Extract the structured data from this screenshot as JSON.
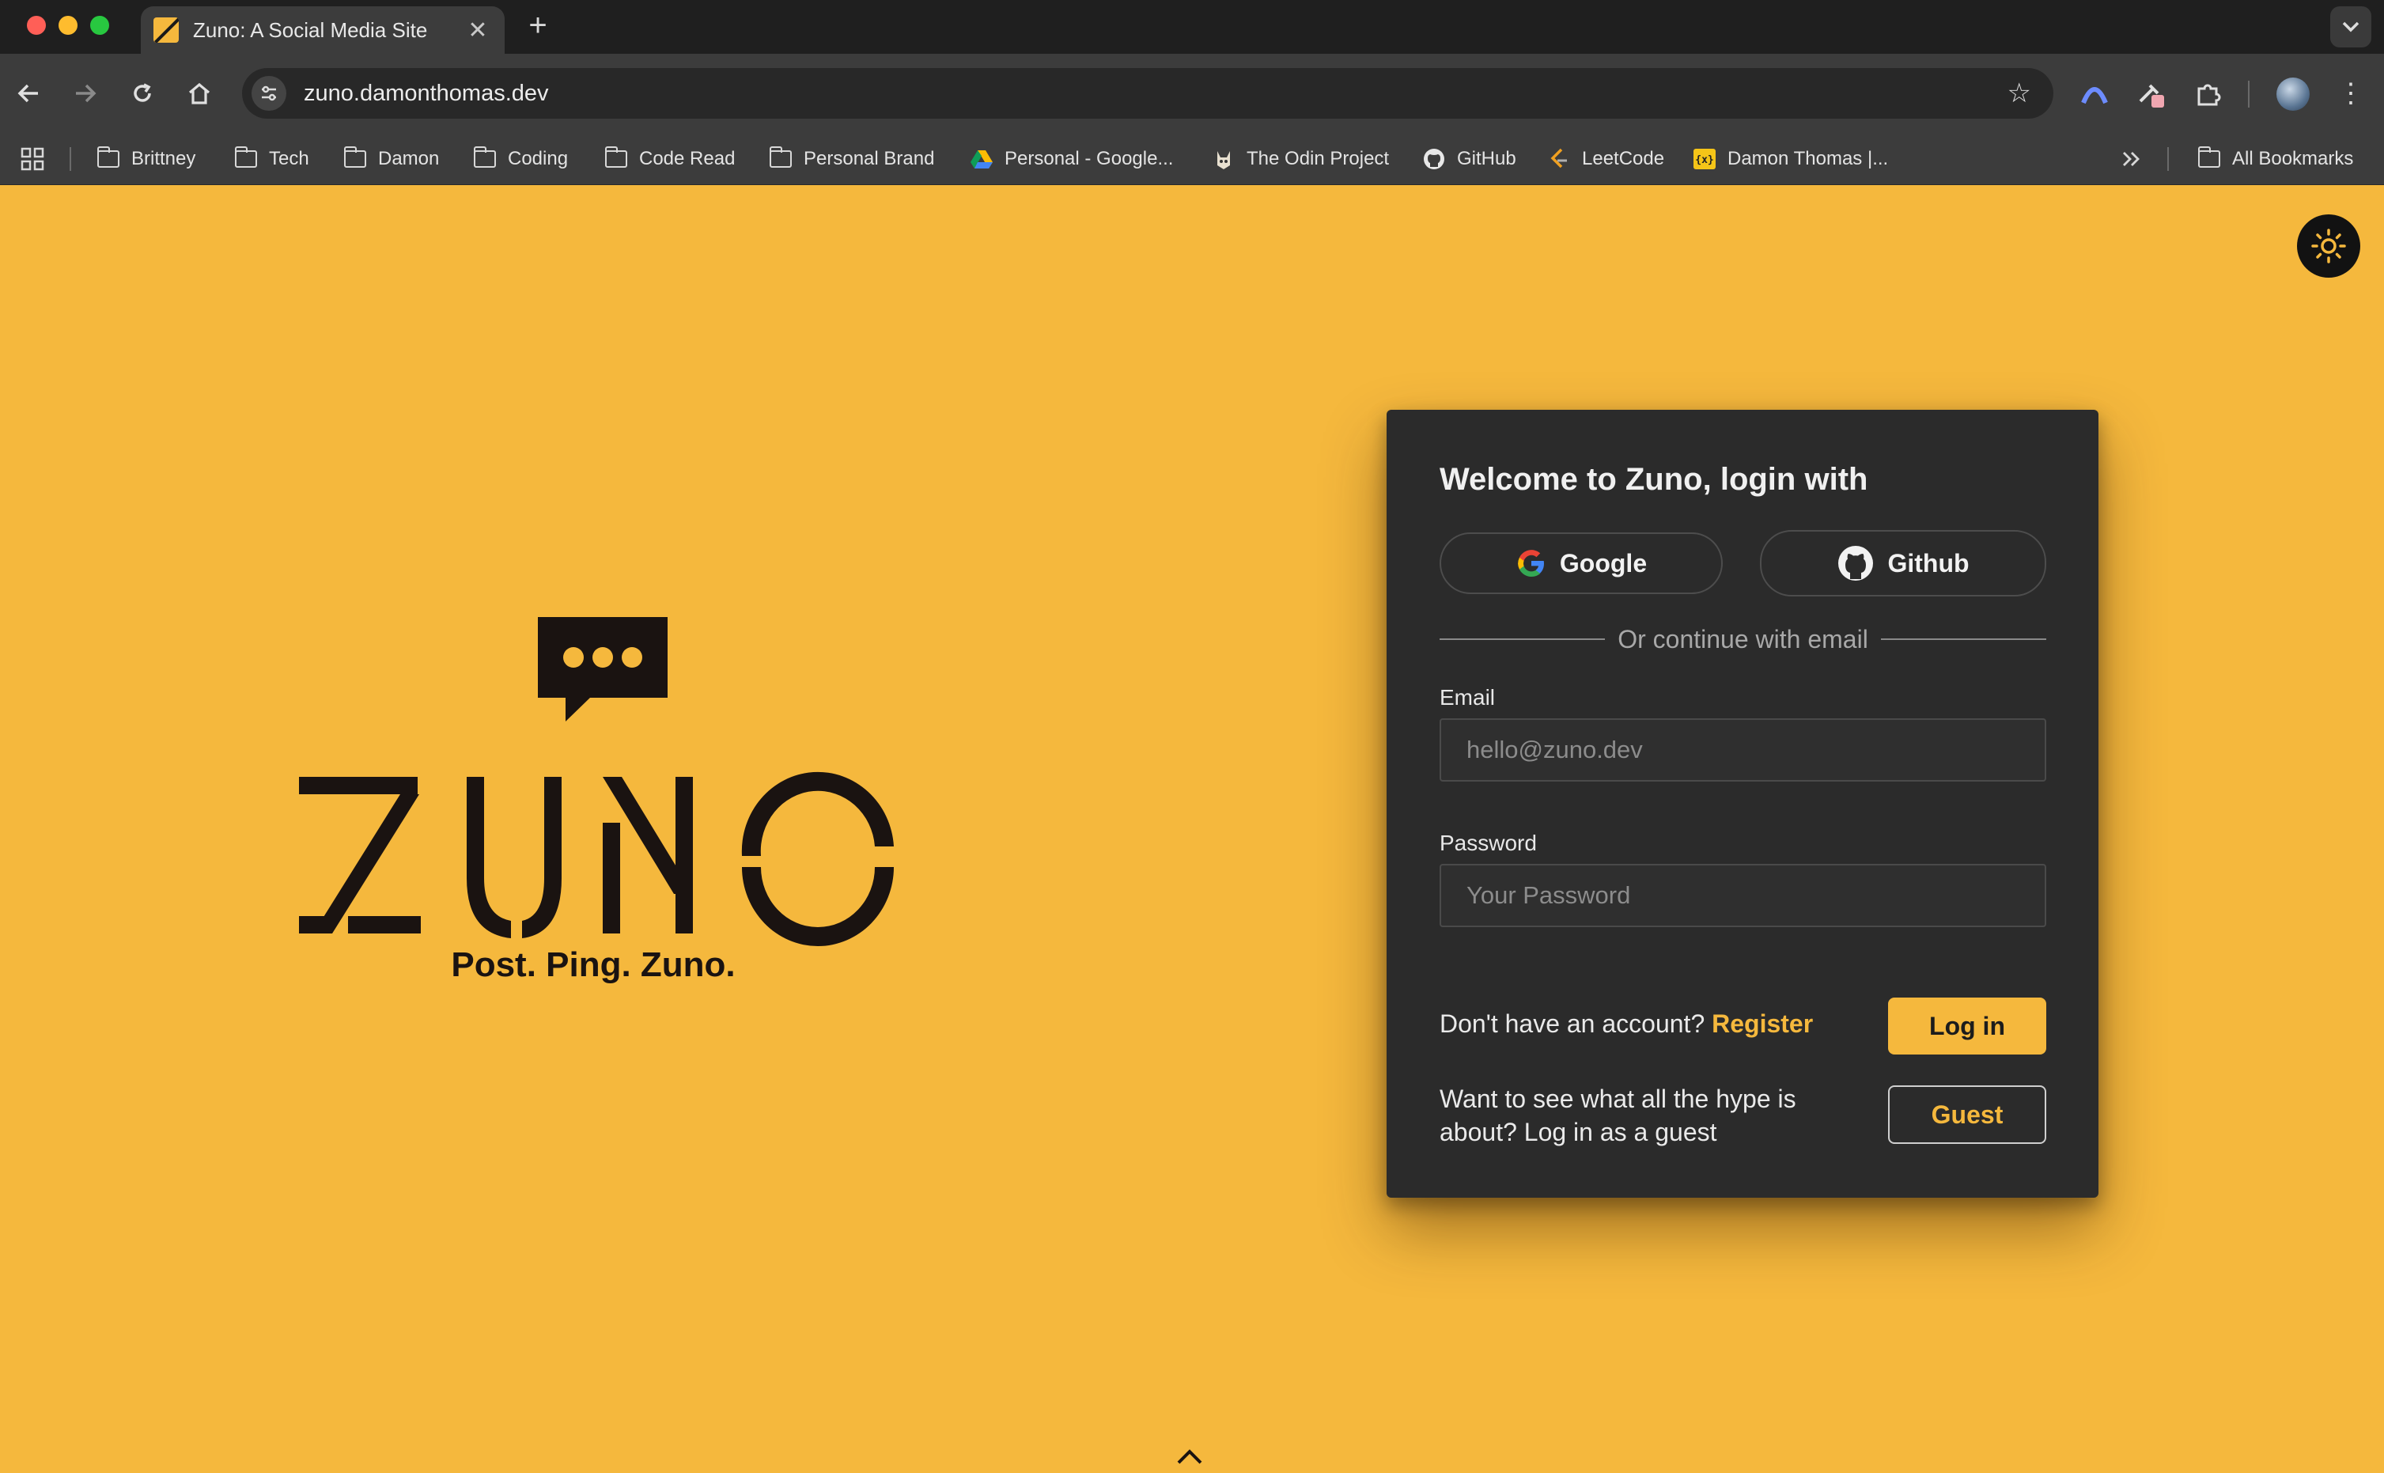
{
  "browser": {
    "tab_title": "Zuno: A Social Media Site",
    "tab_favicon": "zuno-favicon",
    "url": "zuno.damonthomas.dev",
    "icons": {
      "back": "arrow-left-icon",
      "forward": "arrow-right-icon",
      "reload": "reload-icon",
      "home": "home-icon",
      "site_info": "tune-icon",
      "bookmark_star": "star-icon",
      "extensions": "puzzle-icon",
      "menu": "more-vertical-icon",
      "new_tab": "plus-icon",
      "tab_search": "chevron-down-icon",
      "apps": "grid-icon",
      "overflow": "double-chevron-right-icon"
    }
  },
  "bookmarks": [
    {
      "label": "Brittney",
      "icon": "folder-icon"
    },
    {
      "label": "Tech",
      "icon": "folder-icon"
    },
    {
      "label": "Damon",
      "icon": "folder-icon"
    },
    {
      "label": "Coding",
      "icon": "folder-icon"
    },
    {
      "label": "Code Read",
      "icon": "folder-icon"
    },
    {
      "label": "Personal Brand",
      "icon": "folder-icon"
    },
    {
      "label": "Personal - Google...",
      "icon": "google-drive-icon"
    },
    {
      "label": "The Odin Project",
      "icon": "odin-project-icon"
    },
    {
      "label": "GitHub",
      "icon": "github-icon"
    },
    {
      "label": "LeetCode",
      "icon": "leetcode-icon"
    },
    {
      "label": "Damon Thomas |...",
      "icon": "portfolio-icon"
    }
  ],
  "all_bookmarks_label": "All Bookmarks",
  "page": {
    "brand": {
      "wordmark": "ZUNO",
      "tagline": "Post. Ping. Zuno."
    },
    "theme_toggle_icon": "sun-icon",
    "login_card": {
      "title": "Welcome to Zuno, login with",
      "google_label": "Google",
      "github_label": "Github",
      "divider_text": "Or continue with email",
      "email_label": "Email",
      "email_placeholder": "hello@zuno.dev",
      "email_value": "",
      "password_label": "Password",
      "password_placeholder": "Your Password",
      "password_value": "",
      "no_account_text": "Don't have an account?",
      "register_link": "Register",
      "login_button": "Log in",
      "guest_text": "Want to see what all the hype is about? Log in as a guest",
      "guest_button": "Guest"
    },
    "scroll_icon": "chevron-up-icon"
  },
  "colors": {
    "page_background": "#f5b83d",
    "card_background": "#2b2b2b",
    "accent": "#f5b83d",
    "logo": "#1a1311"
  }
}
